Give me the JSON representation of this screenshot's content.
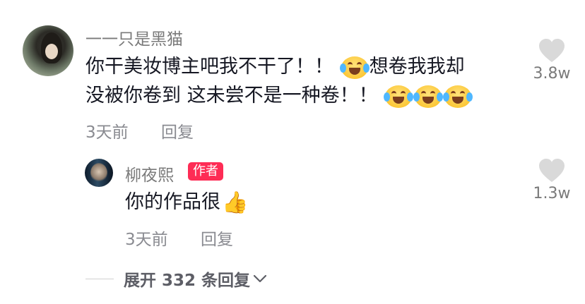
{
  "comment": {
    "username": "一一只是黑猫",
    "text_line1": "你干美妆博主吧我不干了！！",
    "text_line1_after_emoji": "想卷我我却",
    "text_line2": "没被你卷到 这未尝不是一种卷！！",
    "emoji_name": "laugh-cry-emoji",
    "time": "3天前",
    "reply_label": "回复",
    "like_count": "3.8w"
  },
  "reply": {
    "username": "柳夜熙",
    "author_badge": "作者",
    "text": "你的作品很",
    "thumb_emoji": "👍",
    "time": "3天前",
    "reply_label": "回复",
    "like_count": "1.3w"
  },
  "expand": {
    "label": "展开 332 条回复"
  },
  "colors": {
    "badge": "#fe2c55",
    "heart": "#d9d9d9",
    "username": "#7a7a7a",
    "text": "#161823"
  }
}
